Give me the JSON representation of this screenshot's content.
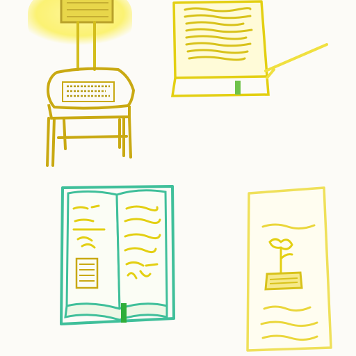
{
  "illustration": {
    "items": [
      {
        "name": "lamp-on-stool"
      },
      {
        "name": "paper-sheet"
      },
      {
        "name": "open-book"
      },
      {
        "name": "plant-card"
      }
    ]
  },
  "colors": {
    "yellow_outline": "#e3cf12",
    "yellow_glow": "#fbf05c",
    "olive_outline": "#c9a912",
    "teal_outline": "#3fbf9a",
    "green_bookmark": "#2fae3a",
    "background": "#fcfbf7"
  }
}
